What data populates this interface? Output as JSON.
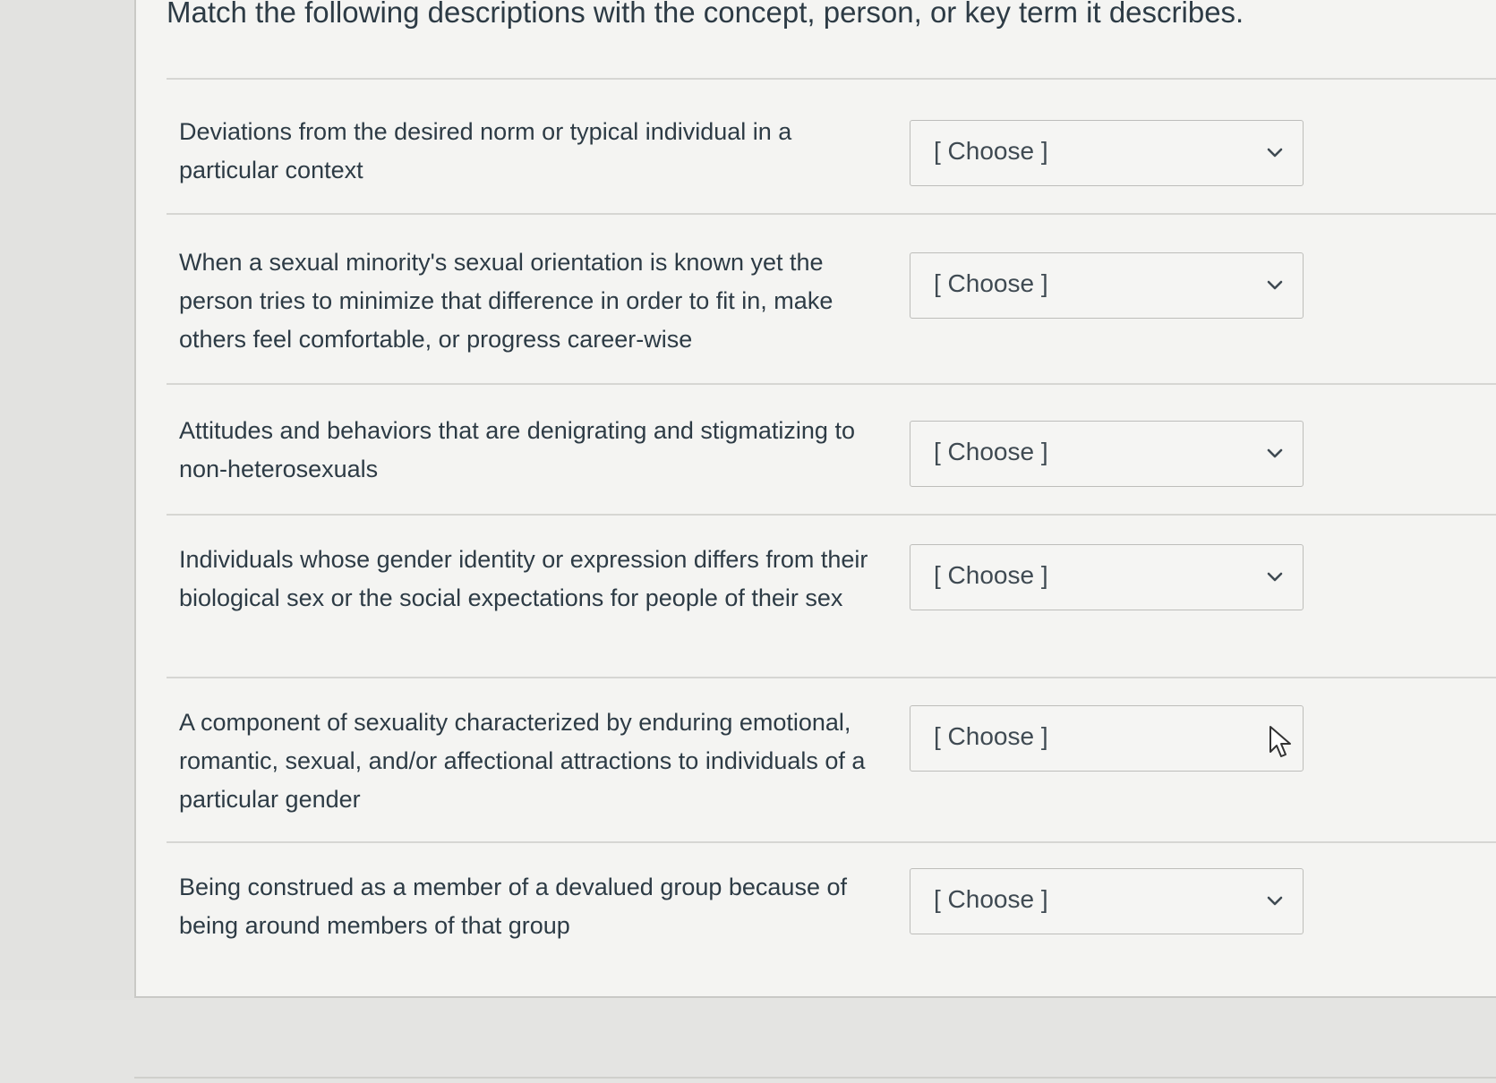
{
  "question": {
    "text": "Match the following descriptions with the concept, person, or key term it describes."
  },
  "matches": [
    {
      "prompt": "Deviations from the desired norm or typical individual in a particular context",
      "select_value": "[ Choose ]"
    },
    {
      "prompt": "When a sexual minority's sexual orientation is known yet the person tries to minimize that difference in order to fit in, make others feel comfortable, or progress career-wise",
      "select_value": "[ Choose ]"
    },
    {
      "prompt": "Attitudes and behaviors that are denigrating and stigmatizing to non-heterosexuals",
      "select_value": "[ Choose ]"
    },
    {
      "prompt": "Individuals whose gender identity or expression differs from their biological sex or the social expectations for people of their sex",
      "select_value": "[ Choose ]"
    },
    {
      "prompt": "A component of sexuality characterized by enduring emotional, romantic, sexual, and/or affectional attractions to individuals of a particular gender",
      "select_value": "[ Choose ]"
    },
    {
      "prompt": "Being construed as a member of a devalued group because of being around members of that group",
      "select_value": "[ Choose ]"
    }
  ],
  "icons": {
    "dropdown": "chevron-down-icon",
    "cursor": "mouse-pointer-icon"
  }
}
